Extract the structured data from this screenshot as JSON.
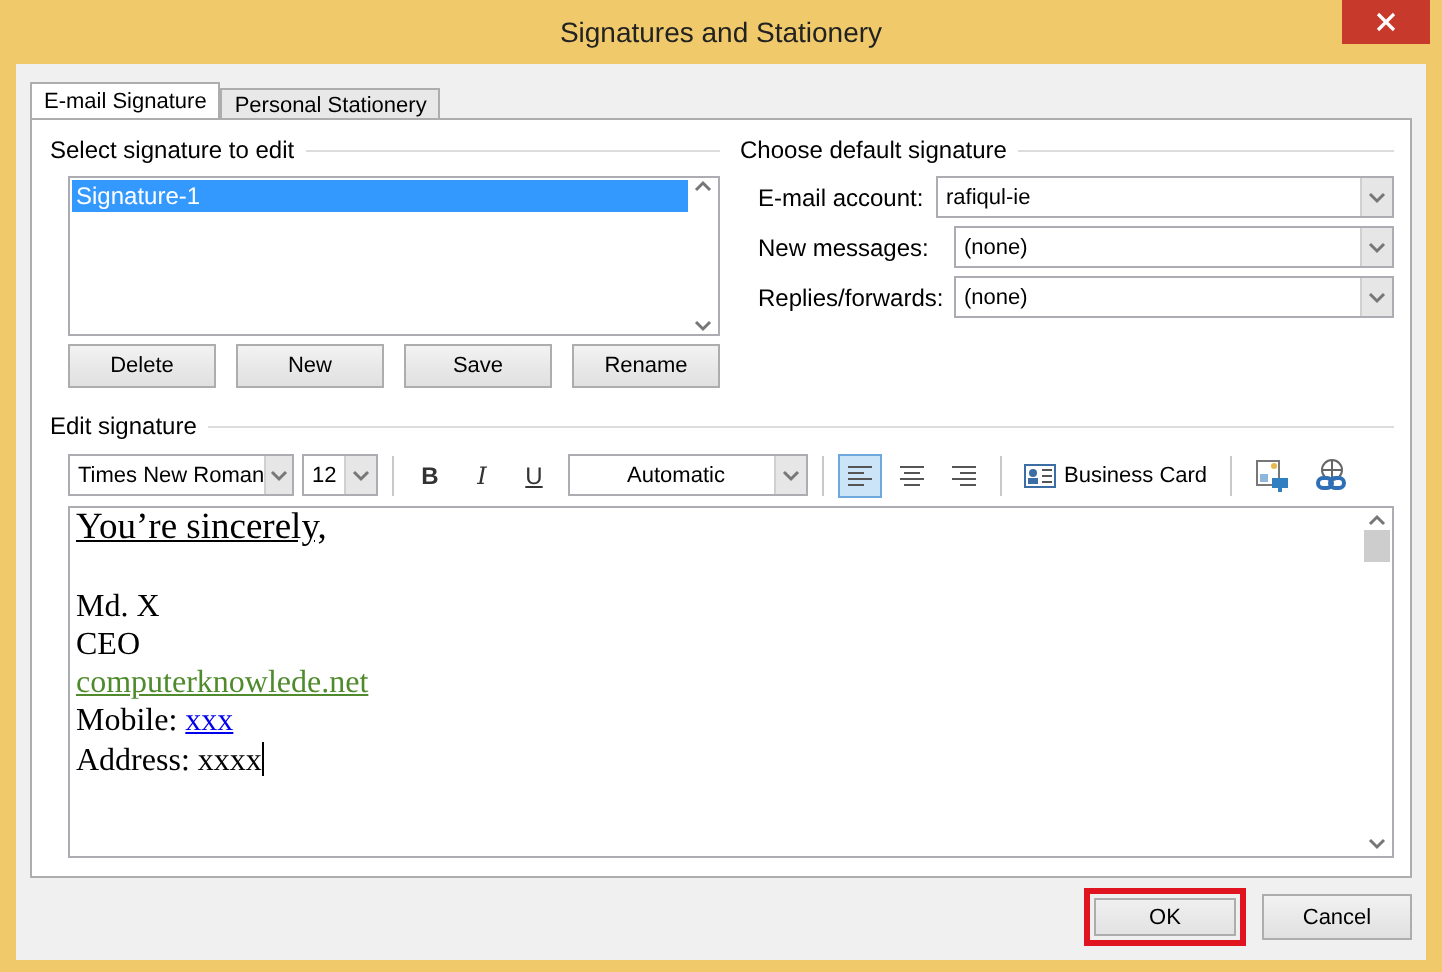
{
  "window": {
    "title": "Signatures and Stationery"
  },
  "tabs": [
    {
      "label": "E-mail Signature",
      "selected": true
    },
    {
      "label": "Personal Stationery",
      "selected": false
    }
  ],
  "select_signature": {
    "label": "Select signature to edit",
    "items": [
      {
        "label": "Signature-1",
        "selected": true
      }
    ],
    "buttons": [
      "Delete",
      "New",
      "Save",
      "Rename"
    ]
  },
  "default_signature": {
    "label": "Choose default signature",
    "fields": [
      {
        "label": "E-mail account:",
        "value": "rafiqul-ie"
      },
      {
        "label": "New messages:",
        "value": "(none)"
      },
      {
        "label": "Replies/forwards:",
        "value": "(none)"
      }
    ]
  },
  "edit_signature": {
    "label": "Edit signature",
    "font": "Times New Roman",
    "size": "12",
    "format_buttons": [
      "B",
      "I",
      "U"
    ],
    "text_color": "Automatic",
    "alignments": [
      {
        "kind": "left",
        "selected": true
      },
      {
        "kind": "center",
        "selected": false
      },
      {
        "kind": "right",
        "selected": false
      }
    ],
    "business_card": "Business Card",
    "lines": [
      {
        "kind": "underlined",
        "text": "You’re sincerely,"
      },
      {
        "kind": "blank"
      },
      {
        "kind": "plain",
        "text": "Md. X"
      },
      {
        "kind": "plain",
        "text": "CEO"
      },
      {
        "kind": "site-link",
        "text": "computerknowlede.net"
      },
      {
        "kind": "labelled-link",
        "text": "Mobile:",
        "link": "xxx"
      },
      {
        "kind": "plain",
        "text": "Address: xxxx",
        "caret": true
      }
    ]
  },
  "buttons": [
    {
      "label": "OK",
      "highlighted": true
    },
    {
      "label": "Cancel",
      "highlighted": false
    }
  ]
}
